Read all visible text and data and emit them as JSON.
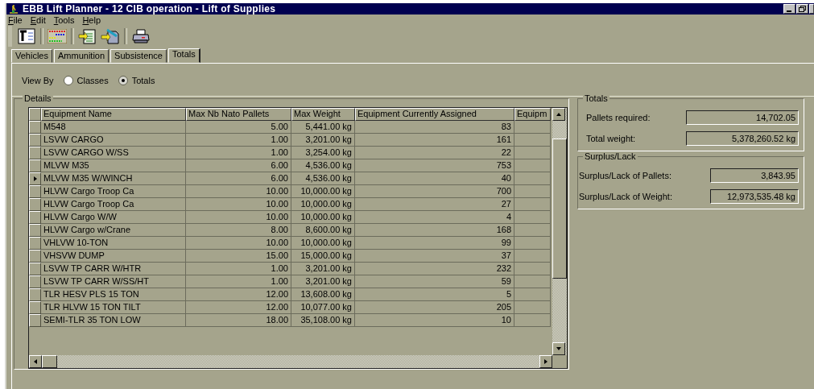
{
  "window": {
    "title": "EBB Lift Planner - 12 CIB operation - Lift of Supplies"
  },
  "menu": [
    "File",
    "Edit",
    "Tools",
    "Help"
  ],
  "tabs": [
    {
      "label": "Vehicles",
      "selected": false
    },
    {
      "label": "Ammunition",
      "selected": false
    },
    {
      "label": "Subsistence",
      "selected": false
    },
    {
      "label": "Totals",
      "selected": true
    }
  ],
  "view_by": {
    "label": "View By",
    "options": [
      {
        "label": "Classes",
        "selected": false
      },
      {
        "label": "Totals",
        "selected": true
      }
    ]
  },
  "details": {
    "title": "Details",
    "columns": [
      "Equipment Name",
      "Max Nb Nato Pallets",
      "Max Weight",
      "Equipment Currently Assigned",
      "Equipm"
    ],
    "rows": [
      {
        "name": "M548",
        "pallets": "5.00",
        "weight": "5,441.00 kg",
        "assigned": "83",
        "selected": false
      },
      {
        "name": "LSVW CARGO",
        "pallets": "1.00",
        "weight": "3,201.00 kg",
        "assigned": "161",
        "selected": false
      },
      {
        "name": "LSVW CARGO W/SS",
        "pallets": "1.00",
        "weight": "3,254.00 kg",
        "assigned": "22",
        "selected": false
      },
      {
        "name": "MLVW M35",
        "pallets": "6.00",
        "weight": "4,536.00 kg",
        "assigned": "753",
        "selected": false
      },
      {
        "name": "MLVW M35 W/WINCH",
        "pallets": "6.00",
        "weight": "4,536.00 kg",
        "assigned": "40",
        "selected": true
      },
      {
        "name": "HLVW Cargo Troop  Ca",
        "pallets": "10.00",
        "weight": "10,000.00 kg",
        "assigned": "700",
        "selected": false
      },
      {
        "name": "HLVW Cargo Troop  Ca",
        "pallets": "10.00",
        "weight": "10,000.00 kg",
        "assigned": "27",
        "selected": false
      },
      {
        "name": "HLVW Cargo W/W",
        "pallets": "10.00",
        "weight": "10,000.00 kg",
        "assigned": "4",
        "selected": false
      },
      {
        "name": "HLVW Cargo w/Crane",
        "pallets": "8.00",
        "weight": "8,600.00 kg",
        "assigned": "168",
        "selected": false
      },
      {
        "name": "VHLVW 10-TON",
        "pallets": "10.00",
        "weight": "10,000.00 kg",
        "assigned": "99",
        "selected": false
      },
      {
        "name": "VHSVW DUMP",
        "pallets": "15.00",
        "weight": "15,000.00 kg",
        "assigned": "37",
        "selected": false
      },
      {
        "name": "LSVW TP CARR W/HTR",
        "pallets": "1.00",
        "weight": "3,201.00 kg",
        "assigned": "232",
        "selected": false
      },
      {
        "name": "LSVW TP CARR W/SS/HT",
        "pallets": "1.00",
        "weight": "3,201.00 kg",
        "assigned": "59",
        "selected": false
      },
      {
        "name": "TLR HESV PLS 15 TON",
        "pallets": "12.00",
        "weight": "13,608.00 kg",
        "assigned": "5",
        "selected": false
      },
      {
        "name": "TLR HLVW 15 TON TILT",
        "pallets": "12.00",
        "weight": "10,077.00 kg",
        "assigned": "205",
        "selected": false
      },
      {
        "name": "SEMI-TLR 35 TON LOW",
        "pallets": "18.00",
        "weight": "35,108.00 kg",
        "assigned": "10",
        "selected": false
      }
    ]
  },
  "totals": {
    "title": "Totals",
    "fields": [
      {
        "label": "Pallets required:",
        "value": "14,702.05"
      },
      {
        "label": "Total weight:",
        "value": "5,378,260.52 kg"
      }
    ]
  },
  "surplus": {
    "title": "Surplus/Lack",
    "fields": [
      {
        "label": "Surplus/Lack of Pallets:",
        "value": "3,843.95"
      },
      {
        "label": "Surplus/Lack of Weight:",
        "value": "12,973,535.48 kg"
      }
    ]
  }
}
